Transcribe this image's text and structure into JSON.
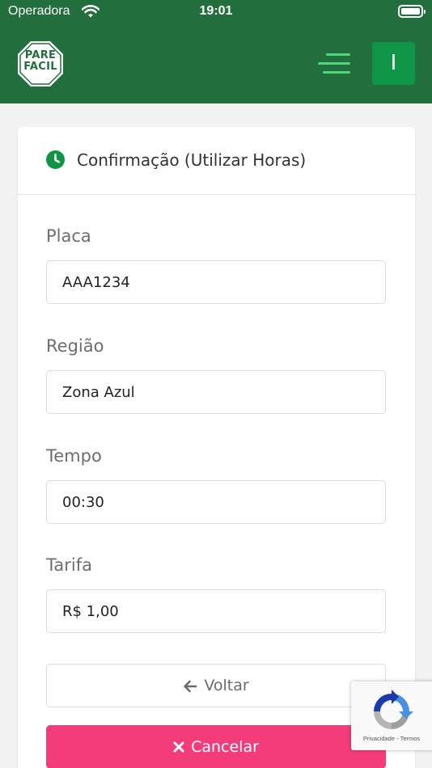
{
  "status_bar": {
    "carrier": "Operadora",
    "time": "19:01",
    "icons": [
      "wifi-icon",
      "battery-icon"
    ]
  },
  "navbar": {
    "logo_text_line1": "PARE",
    "logo_text_line2": "FACIL",
    "avatar_initial": "I",
    "icons": [
      "menu-icon"
    ]
  },
  "card": {
    "title": "Confirmação (Utilizar Horas)",
    "title_icon": "clock-icon",
    "fields": [
      {
        "label": "Placa",
        "value": "AAA1234"
      },
      {
        "label": "Região",
        "value": "Zona Azul"
      },
      {
        "label": "Tempo",
        "value": "00:30"
      },
      {
        "label": "Tarifa",
        "value": "R$ 1,00"
      }
    ],
    "back_button": {
      "label": "Voltar",
      "icon": "arrow-left-icon"
    },
    "cancel_button": {
      "label": "Cancelar",
      "icon": "close-icon"
    }
  },
  "recaptcha": {
    "privacy": "Privacidade",
    "separator": "-",
    "terms": "Termos"
  },
  "colors": {
    "header": "#226f3d",
    "accent_green": "#0e9646",
    "menu_lines": "#4cd97b",
    "cancel": "#f53c7a",
    "background": "#f2f2f2"
  }
}
